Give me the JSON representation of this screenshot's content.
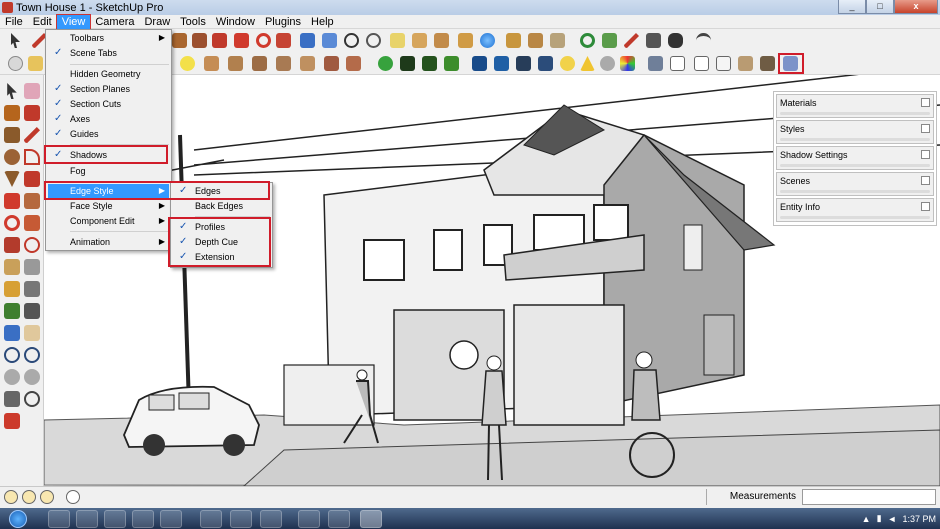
{
  "window": {
    "title": "Town House 1 - SketchUp Pro",
    "minimize": "_",
    "maximize": "□",
    "close": "x"
  },
  "menubar": [
    "File",
    "Edit",
    "View",
    "Camera",
    "Draw",
    "Tools",
    "Window",
    "Plugins",
    "Help"
  ],
  "view_menu": {
    "items": [
      {
        "label": "Toolbars",
        "checked": false,
        "submenu": true
      },
      {
        "label": "Scene Tabs",
        "checked": true,
        "submenu": false
      },
      {
        "label": "Hidden Geometry",
        "checked": false,
        "submenu": false
      },
      {
        "label": "Section Planes",
        "checked": true,
        "submenu": false
      },
      {
        "label": "Section Cuts",
        "checked": true,
        "submenu": false
      },
      {
        "label": "Axes",
        "checked": true,
        "submenu": false
      },
      {
        "label": "Guides",
        "checked": true,
        "submenu": false
      },
      {
        "label": "Shadows",
        "checked": true,
        "submenu": false
      },
      {
        "label": "Fog",
        "checked": false,
        "submenu": false
      },
      {
        "label": "Edge Style",
        "checked": false,
        "submenu": true,
        "highlighted": true
      },
      {
        "label": "Face Style",
        "checked": false,
        "submenu": true
      },
      {
        "label": "Component Edit",
        "checked": false,
        "submenu": true
      },
      {
        "label": "Animation",
        "checked": false,
        "submenu": true
      }
    ]
  },
  "edge_style_submenu": {
    "items": [
      {
        "label": "Edges",
        "checked": true
      },
      {
        "label": "Back Edges",
        "checked": false
      },
      {
        "label": "Profiles",
        "checked": true
      },
      {
        "label": "Depth Cue",
        "checked": true
      },
      {
        "label": "Extension",
        "checked": true
      }
    ]
  },
  "default_tray": {
    "panels": [
      "Materials",
      "Styles",
      "Shadow Settings",
      "Scenes",
      "Entity Info"
    ]
  },
  "statusbar": {
    "measurements_label": "Measurements",
    "measurements_value": ""
  },
  "taskbar": {
    "time": "1:37 PM"
  },
  "colors": {
    "highlight": "#3399ff",
    "annotation_red": "#d01c2a",
    "check_blue": "#1a56b0"
  }
}
